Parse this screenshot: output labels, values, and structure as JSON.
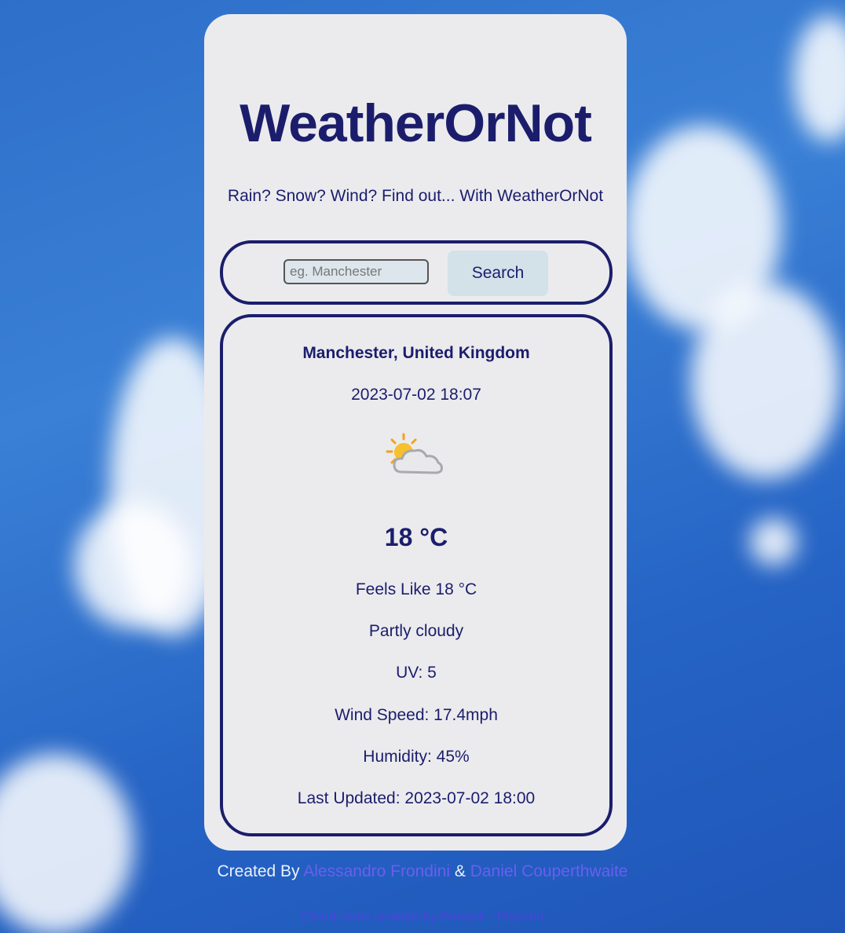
{
  "app": {
    "title": "WeatherOrNot",
    "tagline": "Rain? Snow? Wind? Find out... With WeatherOrNot"
  },
  "search": {
    "placeholder": "eg. Manchester",
    "value": "",
    "button_label": "Search"
  },
  "weather": {
    "location": "Manchester, United Kingdom",
    "datetime": "2023-07-02 18:07",
    "icon": "partly-cloudy-icon",
    "temperature": "18 °C",
    "feels_like": "Feels Like 18 °C",
    "condition": "Partly cloudy",
    "uv": "UV: 5",
    "wind_speed": "Wind Speed: 17.4mph",
    "humidity": "Humidity: 45%",
    "last_updated": "Last Updated: 2023-07-02 18:00"
  },
  "footer": {
    "created_by": "Created By",
    "author1": "Alessandro Frondini",
    "ampersand": "&",
    "author2": "Daniel Couperthwaite",
    "icon_credit_prefix": "Cloud icons created by Freepik - Flaticon"
  },
  "colors": {
    "accent": "#1b1d6c",
    "card_background": "#ebebee",
    "link": "#6a5ef0"
  }
}
